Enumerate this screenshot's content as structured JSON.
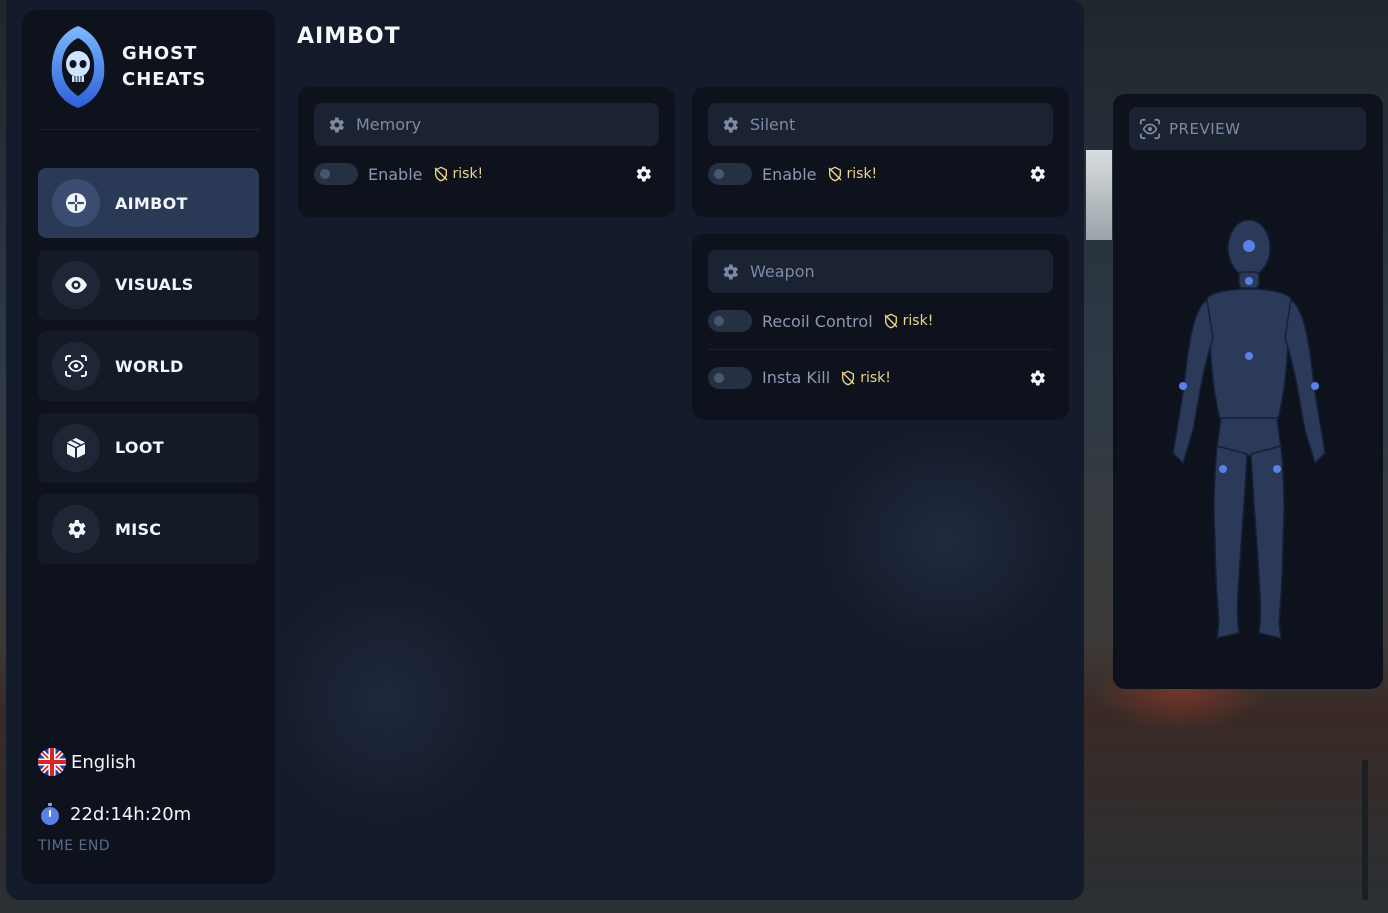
{
  "brand": {
    "line1": "GHOST",
    "line2": "CHEATS",
    "logo_icon": "ghost-skull-icon"
  },
  "page_title": "AIMBOT",
  "nav": [
    {
      "id": "aimbot",
      "label": "AIMBOT",
      "icon": "crosshair-icon",
      "active": true
    },
    {
      "id": "visuals",
      "label": "VISUALS",
      "icon": "eye-icon",
      "active": false
    },
    {
      "id": "world",
      "label": "WORLD",
      "icon": "scan-eye-icon",
      "active": false
    },
    {
      "id": "loot",
      "label": "LOOT",
      "icon": "box-icon",
      "active": false
    },
    {
      "id": "misc",
      "label": "MISC",
      "icon": "gear-icon",
      "active": false
    }
  ],
  "language": {
    "label": "English",
    "flag": "uk-flag-icon"
  },
  "timer": {
    "value": "22d:14h:20m",
    "caption": "TIME END"
  },
  "cards": {
    "memory": {
      "title": "Memory",
      "rows": [
        {
          "label": "Enable",
          "risk": "risk!",
          "enabled": false,
          "has_settings": true
        }
      ]
    },
    "silent": {
      "title": "Silent",
      "rows": [
        {
          "label": "Enable",
          "risk": "risk!",
          "enabled": false,
          "has_settings": true
        }
      ]
    },
    "weapon": {
      "title": "Weapon",
      "rows": [
        {
          "label": "Recoil Control",
          "risk": "risk!",
          "enabled": false,
          "has_settings": false
        },
        {
          "label": "Insta Kill",
          "risk": "risk!",
          "enabled": false,
          "has_settings": true
        }
      ]
    }
  },
  "preview": {
    "title": "PREVIEW",
    "icon": "scan-eye-icon"
  },
  "colors": {
    "accent": "#2a3a56",
    "risk": "#f0d48a",
    "bone_dot": "#5b7fe8"
  }
}
